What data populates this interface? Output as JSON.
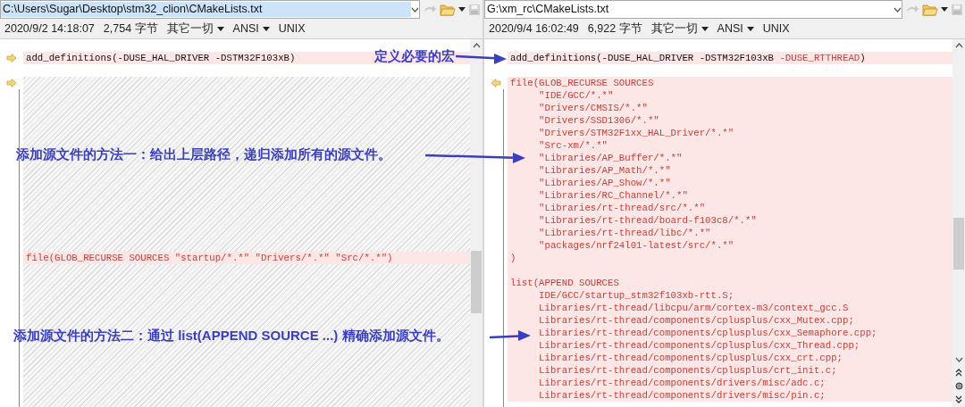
{
  "panes": [
    {
      "path": "C:\\Users\\Sugar\\Desktop\\stm32_clion\\CMakeLists.txt",
      "path_selected": true,
      "info": [
        {
          "text": "2020/9/2 14:18:07",
          "dropdown": false
        },
        {
          "text": "2,754 字节",
          "dropdown": false
        },
        {
          "text": "其它一切",
          "dropdown": true
        },
        {
          "text": "ANSI",
          "dropdown": true
        },
        {
          "text": "UNIX",
          "dropdown": false
        }
      ],
      "lines": [
        {
          "kind": "blank"
        },
        {
          "kind": "diff",
          "marker": true,
          "segments": [
            {
              "text": "add_definitions(-DUSE_HAL_DRIVER -DSTM32F103xB)",
              "changed": false
            }
          ]
        },
        {
          "kind": "blank"
        },
        {
          "kind": "gap",
          "marker": true
        },
        {
          "kind": "gap"
        },
        {
          "kind": "gap"
        },
        {
          "kind": "gap"
        },
        {
          "kind": "gap"
        },
        {
          "kind": "gap"
        },
        {
          "kind": "gap"
        },
        {
          "kind": "gap"
        },
        {
          "kind": "gap"
        },
        {
          "kind": "gap"
        },
        {
          "kind": "gap"
        },
        {
          "kind": "gap"
        },
        {
          "kind": "gap"
        },
        {
          "kind": "gap"
        },
        {
          "kind": "diff",
          "segments": [
            {
              "text": "file(GLOB_RECURSE SOURCES \"startup/*.*\" \"Drivers/*.*\" \"Src/*.*\")",
              "changed": true
            }
          ]
        },
        {
          "kind": "gap"
        },
        {
          "kind": "gap"
        },
        {
          "kind": "gap"
        },
        {
          "kind": "gap"
        },
        {
          "kind": "gap"
        },
        {
          "kind": "gap"
        },
        {
          "kind": "gap"
        },
        {
          "kind": "gap"
        },
        {
          "kind": "gap"
        },
        {
          "kind": "gap"
        }
      ]
    },
    {
      "path": "G:\\xm_rc\\CMakeLists.txt",
      "path_selected": false,
      "info": [
        {
          "text": "2020/9/4 16:02:49",
          "dropdown": false
        },
        {
          "text": "6,922 字节",
          "dropdown": false
        },
        {
          "text": "其它一切",
          "dropdown": true
        },
        {
          "text": "ANSI",
          "dropdown": true
        },
        {
          "text": "UNIX",
          "dropdown": false
        }
      ],
      "lines": [
        {
          "kind": "blank"
        },
        {
          "kind": "diff",
          "segments": [
            {
              "text": "add_definitions(-DUSE_HAL_DRIVER -DSTM32F103xB ",
              "changed": false
            },
            {
              "text": "-DUSE_RTTHREAD",
              "changed": true
            },
            {
              "text": ")",
              "changed": false
            }
          ]
        },
        {
          "kind": "blank"
        },
        {
          "kind": "diff",
          "marker": true,
          "segments": [
            {
              "text": "file(GLOB_RECURSE SOURCES",
              "changed": true
            }
          ]
        },
        {
          "kind": "diff",
          "segments": [
            {
              "text": "     \"IDE/GCC/*.*\"",
              "changed": true
            }
          ]
        },
        {
          "kind": "diff",
          "segments": [
            {
              "text": "     \"Drivers/CMSIS/*.*\"",
              "changed": true
            }
          ]
        },
        {
          "kind": "diff",
          "segments": [
            {
              "text": "     \"Drivers/SSD1306/*.*\"",
              "changed": true
            }
          ]
        },
        {
          "kind": "diff",
          "segments": [
            {
              "text": "     \"Drivers/STM32F1xx_HAL_Driver/*.*\"",
              "changed": true
            }
          ]
        },
        {
          "kind": "diff",
          "segments": [
            {
              "text": "     \"Src-xm/*.*\"",
              "changed": true
            }
          ]
        },
        {
          "kind": "diff",
          "segments": [
            {
              "text": "     \"Libraries/AP_Buffer/*.*\"",
              "changed": true
            }
          ]
        },
        {
          "kind": "diff",
          "segments": [
            {
              "text": "     \"Libraries/AP_Math/*.*\"",
              "changed": true
            }
          ]
        },
        {
          "kind": "diff",
          "segments": [
            {
              "text": "     \"Libraries/AP_Show/*.*\"",
              "changed": true
            }
          ]
        },
        {
          "kind": "diff",
          "segments": [
            {
              "text": "     \"Libraries/RC_Channel/*.*\"",
              "changed": true
            }
          ]
        },
        {
          "kind": "diff",
          "segments": [
            {
              "text": "     \"Libraries/rt-thread/src/*.*\"",
              "changed": true
            }
          ]
        },
        {
          "kind": "diff",
          "segments": [
            {
              "text": "     \"Libraries/rt-thread/board-f103c8/*.*\"",
              "changed": true
            }
          ]
        },
        {
          "kind": "diff",
          "segments": [
            {
              "text": "     \"Libraries/rt-thread/libc/*.*\"",
              "changed": true
            }
          ]
        },
        {
          "kind": "diff",
          "segments": [
            {
              "text": "     \"packages/nrf24l01-latest/src/*.*\"",
              "changed": true
            }
          ]
        },
        {
          "kind": "diff",
          "segments": [
            {
              "text": ")",
              "changed": true
            }
          ]
        },
        {
          "kind": "diff"
        },
        {
          "kind": "diff",
          "segments": [
            {
              "text": "list(APPEND SOURCES",
              "changed": true
            }
          ]
        },
        {
          "kind": "diff",
          "segments": [
            {
              "text": "     IDE/GCC/startup_stm32f103xb-rtt.S;",
              "changed": true
            }
          ]
        },
        {
          "kind": "diff",
          "segments": [
            {
              "text": "     Libraries/rt-thread/libcpu/arm/cortex-m3/context_gcc.S",
              "changed": true
            }
          ]
        },
        {
          "kind": "diff",
          "segments": [
            {
              "text": "     Libraries/rt-thread/components/cplusplus/cxx_Mutex.cpp;",
              "changed": true
            }
          ]
        },
        {
          "kind": "diff",
          "segments": [
            {
              "text": "     Libraries/rt-thread/components/cplusplus/cxx_Semaphore.cpp;",
              "changed": true
            }
          ]
        },
        {
          "kind": "diff",
          "segments": [
            {
              "text": "     Libraries/rt-thread/components/cplusplus/cxx_Thread.cpp;",
              "changed": true
            }
          ]
        },
        {
          "kind": "diff",
          "segments": [
            {
              "text": "     Libraries/rt-thread/components/cplusplus/cxx_crt.cpp;",
              "changed": true
            }
          ]
        },
        {
          "kind": "diff",
          "segments": [
            {
              "text": "     Libraries/rt-thread/components/cplusplus/crt_init.c;",
              "changed": true
            }
          ]
        },
        {
          "kind": "diff",
          "segments": [
            {
              "text": "     Libraries/rt-thread/components/drivers/misc/adc.c;",
              "changed": true
            }
          ]
        },
        {
          "kind": "diff",
          "segments": [
            {
              "text": "     Libraries/rt-thread/components/drivers/misc/pin.c;",
              "changed": true
            }
          ]
        }
      ]
    }
  ],
  "annotations": [
    {
      "text": "定义必要的宏"
    },
    {
      "text": "添加源文件的方法一：给出上层路径，递归添加所有的源文件。"
    },
    {
      "text": "添加源文件的方法二：通过 list(APPEND SOURCE ...) 精确添加源文件。"
    }
  ]
}
